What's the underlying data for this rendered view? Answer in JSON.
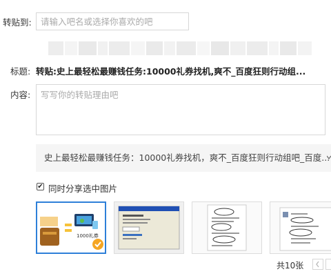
{
  "forward_to": {
    "label": "转贴到:",
    "placeholder": "请输入吧名或选择你喜欢的吧"
  },
  "title": {
    "label": "标题:",
    "value": "转贴:史上最轻松最赚钱任务:10000礼券找机,爽不_百度狂则行动组..."
  },
  "content": {
    "label": "内容:",
    "placeholder": "写写你的转贴理由吧"
  },
  "quote": {
    "text": "史上最轻松最赚钱任务：10000礼券找机，爽不_百度狂则行动组吧_百度..."
  },
  "share": {
    "label": "同时分享选中图片",
    "checked": true
  },
  "thumbnails": [
    {
      "text": "1000礼券",
      "selected": true
    },
    {
      "text": "",
      "selected": false
    },
    {
      "text": "",
      "selected": false
    },
    {
      "text": "",
      "selected": false
    }
  ],
  "pagination": {
    "total": "共10张",
    "prev_icon": "chevron-left-icon",
    "next_icon": "chevron-right-icon"
  },
  "colors": {
    "selected_border": "#2d7fd8",
    "check_badge": "#f5a623"
  }
}
